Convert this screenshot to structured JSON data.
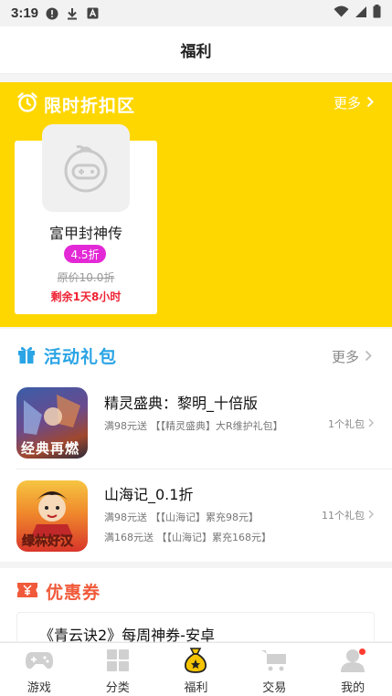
{
  "status_bar": {
    "time": "3:19"
  },
  "header": {
    "title": "福利"
  },
  "discount_section": {
    "title": "限时折扣区",
    "more_label": "更多",
    "games": [
      {
        "name": "富甲封神传",
        "discount": "4.5折",
        "original_price": "原价10.0折",
        "remaining": "剩余1天8小时"
      }
    ]
  },
  "gift_section": {
    "title": "活动礼包",
    "more_label": "更多",
    "items": [
      {
        "name": "精灵盛典：黎明_十倍版",
        "icon_text": "经典再燃",
        "gifts": [
          "满98元送 【【精灵盛典】大R维护礼包】"
        ],
        "count": "1个礼包"
      },
      {
        "name": "山海记_0.1折",
        "icon_text": "绿林好汉",
        "gifts": [
          "满98元送 【【山海记】累充98元】",
          "满168元送 【【山海记】累充168元】"
        ],
        "count": "11个礼包"
      }
    ]
  },
  "coupon_section": {
    "title": "优惠券",
    "card_title": "《青云诀2》每周神券-安卓"
  },
  "bottom_nav": {
    "items": [
      {
        "label": "游戏",
        "icon": "gamepad-icon"
      },
      {
        "label": "分类",
        "icon": "grid-icon"
      },
      {
        "label": "福利",
        "icon": "money-bag-icon"
      },
      {
        "label": "交易",
        "icon": "cart-icon"
      },
      {
        "label": "我的",
        "icon": "user-icon"
      }
    ],
    "active_index": 2
  },
  "colors": {
    "discount_bg": "#ffd700",
    "badge": "#e329d6",
    "gift_title": "#2aa4e5",
    "coupon_title": "#f05a3a",
    "remaining": "#ee2233"
  }
}
